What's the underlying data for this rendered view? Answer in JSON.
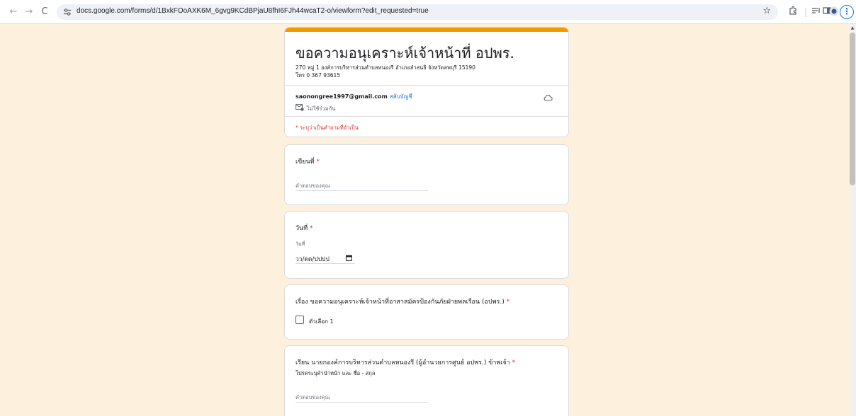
{
  "browser": {
    "url": "docs.google.com/forms/d/1BxkFOoAXK6M_6gvg9KCdBPjaU8fhI6FJh44wcaT2-o/viewform?edit_requested=true",
    "back_icon": "←",
    "forward_icon": "→",
    "reload_icon": "C"
  },
  "form": {
    "title": "ขอความอนุเคราะห์เจ้าหน้าที่ อปพร.",
    "description_line1": "270 หมู่ 1 องค์การบริหารส่วนตำบลหนองรี อำเภอลำสนธิ จังหวัดลพบุรี 15190",
    "description_line2": "โทร 0 367 93615",
    "email": "saonongree1997@gmail.com",
    "switch_account": "สลับบัญชี",
    "not_shared": "ไม่ใช้ร่วมกัน",
    "required_note": "* ระบุว่าเป็นคำถามที่จำเป็น",
    "accent_color": "#f29900"
  },
  "questions": {
    "q1": {
      "title": "เขียนที่",
      "required_mark": "*",
      "placeholder": "คำตอบของคุณ"
    },
    "q2": {
      "title": "วันที่",
      "required_mark": "*",
      "sub_label": "วันที่",
      "date_placeholder": "วว/ดด/ปปปป"
    },
    "q3": {
      "title": "เรื่อง ขอความอนุเคราะห์เจ้าหน้าที่อาสาสมัครป้องกันภัยฝ่ายพลเรือน (อปพร.)",
      "required_mark": "*",
      "option1": "ตัวเลือก 1"
    },
    "q4": {
      "title": "เรียน นายกองค์การบริหารส่วนตำบลหนองรี (ผู้อำนวยการศูนย์ อปพร.) ข้าพเจ้า",
      "required_mark": "*",
      "subtitle": "โปรดระบุคำนำหน้า และ ชื่อ - สกุล",
      "placeholder": "คำตอบของคุณ"
    }
  }
}
